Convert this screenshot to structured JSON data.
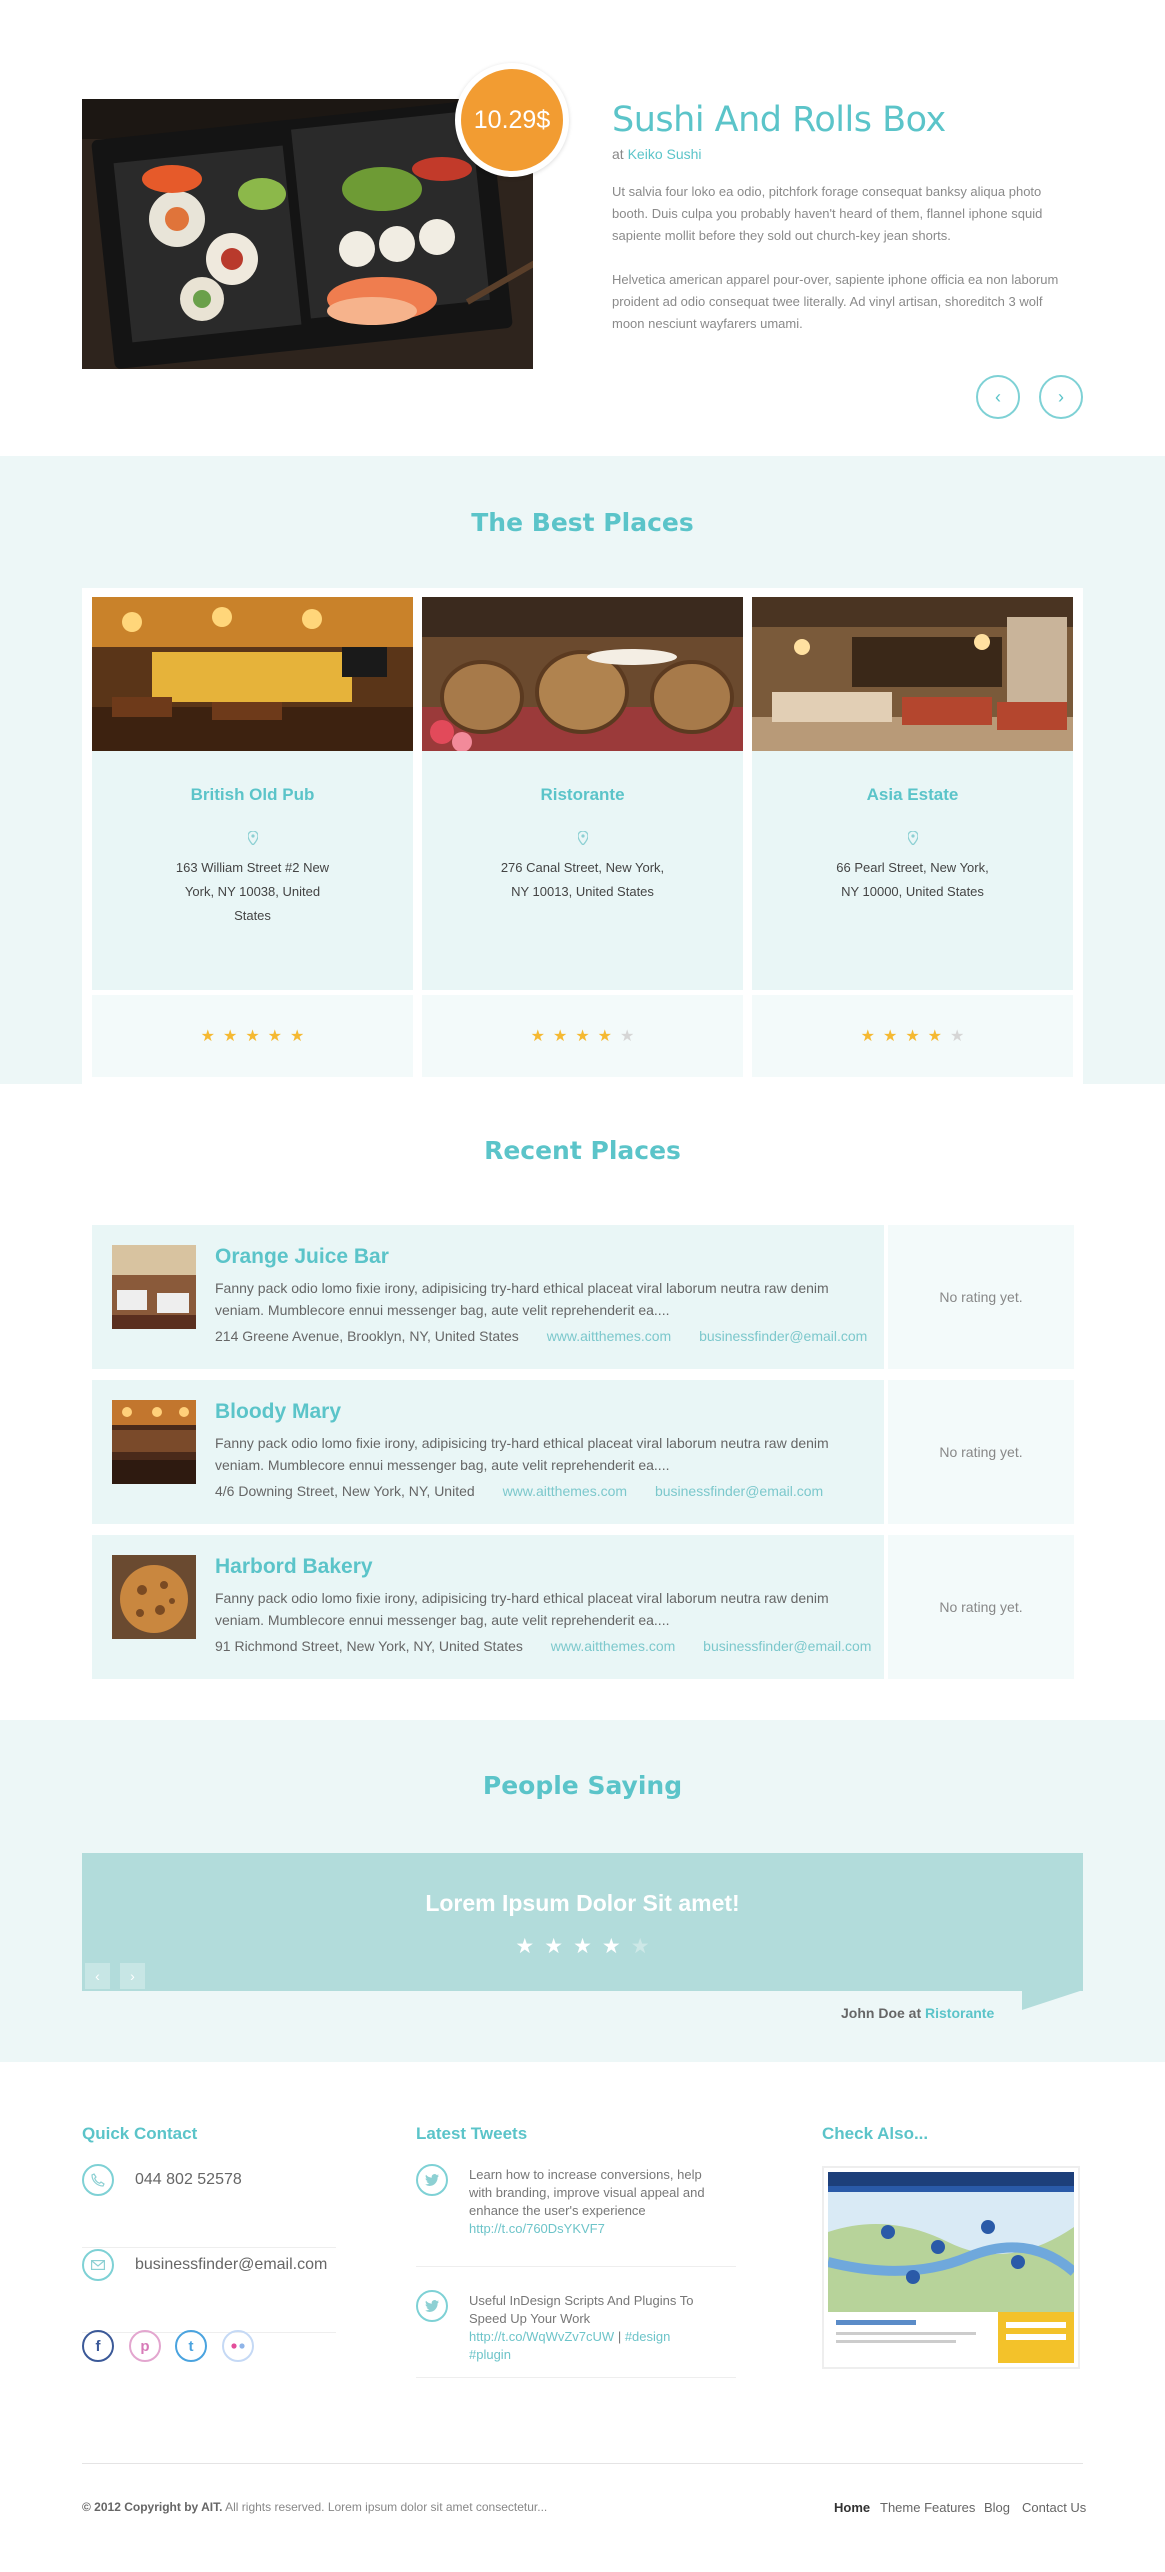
{
  "hero": {
    "price": "10.29$",
    "title": "Sushi And Rolls Box",
    "at_label": "at",
    "venue": "Keiko Sushi",
    "paragraph1": "Ut salvia four loko ea odio, pitchfork forage consequat banksy aliqua photo booth. Duis culpa you probably haven't heard of them, flannel iphone squid sapiente mollit before they sold out church-key jean shorts.",
    "paragraph2": "Helvetica american apparel pour-over, sapiente iphone officia ea non laborum proident ad odio consequat twee literally. Ad vinyl artisan, shoreditch 3 wolf moon nesciunt wayfarers umami.",
    "prev_icon": "chevron-left-icon",
    "next_icon": "chevron-right-icon"
  },
  "best_places": {
    "title": "The Best Places",
    "items": [
      {
        "name": "British Old Pub",
        "address": "163 William Street #2 New York, NY 10038, United States",
        "rating": 5
      },
      {
        "name": "Ristorante",
        "address": "276 Canal Street, New York, NY 10013, United States",
        "rating": 4
      },
      {
        "name": "Asia Estate",
        "address": "66 Pearl Street, New York, NY 10000, United States",
        "rating": 4
      }
    ]
  },
  "recent_places": {
    "title": "Recent Places",
    "items": [
      {
        "name": "Orange Juice Bar",
        "description": "Fanny pack odio lomo fixie irony, adipisicing try-hard ethical placeat viral laborum neutra raw denim veniam. Mumblecore ennui messenger bag, aute velit reprehenderit ea....",
        "address": "214 Greene Avenue, Brooklyn, NY, United States",
        "website": "www.aitthemes.com",
        "email": "businessfinder@email.com",
        "rating_text": "No rating yet."
      },
      {
        "name": "Bloody Mary",
        "description": "Fanny pack odio lomo fixie irony, adipisicing try-hard ethical placeat viral laborum neutra raw denim veniam. Mumblecore ennui messenger bag, aute velit reprehenderit ea....",
        "address": "4/6 Downing Street, New York, NY, United",
        "website": "www.aitthemes.com",
        "email": "businessfinder@email.com",
        "rating_text": "No rating yet."
      },
      {
        "name": "Harbord Bakery",
        "description": "Fanny pack odio lomo fixie irony, adipisicing try-hard ethical placeat viral laborum neutra raw denim veniam. Mumblecore ennui messenger bag, aute velit reprehenderit ea....",
        "address": "91 Richmond Street, New York, NY, United States",
        "website": "www.aitthemes.com",
        "email": "businessfinder@email.com",
        "rating_text": "No rating yet."
      }
    ]
  },
  "testimonials": {
    "title": "People Saying",
    "quote": "Lorem Ipsum Dolor Sit amet!",
    "rating": 4,
    "author": "John Doe",
    "author_at": "at",
    "author_venue": "Ristorante"
  },
  "footer": {
    "quick_contact": {
      "heading": "Quick Contact",
      "phone": "044 802 52578",
      "email": "businessfinder@email.com",
      "socials": [
        "facebook-icon",
        "pinterest-icon",
        "twitter-icon",
        "flickr-icon"
      ]
    },
    "tweets": {
      "heading": "Latest Tweets",
      "items": [
        {
          "text": "Learn how to increase conversions, help with branding, improve visual appeal and enhance the user's experience",
          "link": "http://t.co/760DsYKVF7"
        },
        {
          "text": "Useful InDesign Scripts And Plugins To Speed Up Your Work",
          "link": "http://t.co/WqWvZv7cUW",
          "sep": "|",
          "tag1": "#design",
          "tag2": "#plugin"
        }
      ]
    },
    "check_also": {
      "heading": "Check Also..."
    },
    "copyright_bold": "© 2012 Copyright by AIT.",
    "copyright_rest": "All rights reserved. Lorem ipsum dolor sit amet consectetur...",
    "menu": [
      "Home",
      "Theme Features",
      "Blog",
      "Contact Us"
    ]
  },
  "colors": {
    "accent": "#5bc4c9",
    "price": "#f29c32",
    "star": "#f5b932",
    "band": "#edf7f7"
  }
}
